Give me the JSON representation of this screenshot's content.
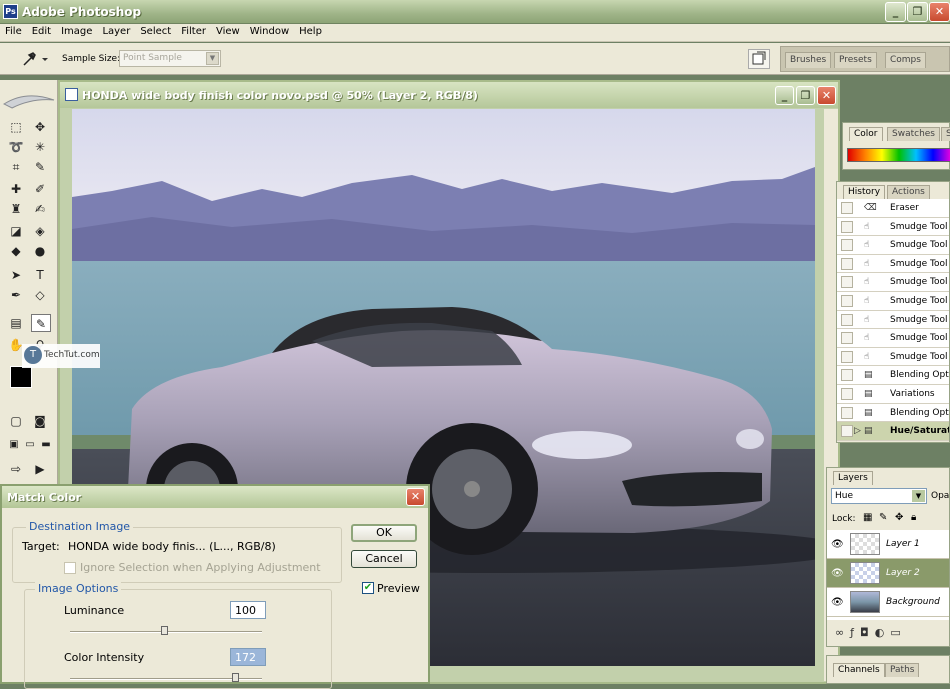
{
  "app": {
    "title": "Adobe Photoshop",
    "logo_text": "Ps"
  },
  "window_buttons": {
    "minimize": "_",
    "restore": "❐",
    "close": "✕"
  },
  "menu": [
    "File",
    "Edit",
    "Image",
    "Layer",
    "Select",
    "Filter",
    "View",
    "Window",
    "Help"
  ],
  "options_bar": {
    "sample_size_label": "Sample Size:",
    "sample_size_value": "Point Sample",
    "palette_well_tabs": [
      "Brushes",
      "Presets",
      "Comps"
    ]
  },
  "document": {
    "title": "HONDA wide body finish color novo.psd @ 50% (Layer 2, RGB/8)"
  },
  "watermark": {
    "text": "TechTut.com"
  },
  "color_panel": {
    "tabs": [
      "Color",
      "Swatches",
      "S"
    ]
  },
  "history_panel": {
    "tabs": [
      "History",
      "Actions"
    ],
    "items": [
      {
        "label": "Eraser",
        "icon": "eraser-icon"
      },
      {
        "label": "Smudge Tool",
        "icon": "smudge-icon"
      },
      {
        "label": "Smudge Tool",
        "icon": "smudge-icon"
      },
      {
        "label": "Smudge Tool",
        "icon": "smudge-icon"
      },
      {
        "label": "Smudge Tool",
        "icon": "smudge-icon"
      },
      {
        "label": "Smudge Tool",
        "icon": "smudge-icon"
      },
      {
        "label": "Smudge Tool",
        "icon": "smudge-icon"
      },
      {
        "label": "Smudge Tool",
        "icon": "smudge-icon"
      },
      {
        "label": "Smudge Tool",
        "icon": "smudge-icon"
      },
      {
        "label": "Blending Optio",
        "icon": "doc-icon"
      },
      {
        "label": "Variations",
        "icon": "doc-icon"
      },
      {
        "label": "Blending Optio",
        "icon": "doc-icon"
      },
      {
        "label": "Hue/Saturatio",
        "icon": "doc-icon",
        "selected": true
      }
    ]
  },
  "layers_panel": {
    "tab": "Layers",
    "blend_mode": "Hue",
    "opacity_label": "Opa",
    "lock_label": "Lock:",
    "layers": [
      {
        "name": "Layer 1",
        "selected": false
      },
      {
        "name": "Layer 2",
        "selected": true
      },
      {
        "name": "Background",
        "selected": false
      }
    ]
  },
  "bottom_panel": {
    "tabs": [
      "Channels",
      "Paths"
    ]
  },
  "match_color_dialog": {
    "title": "Match Color",
    "close": "✕",
    "destination_group": "Destination Image",
    "target_label": "Target:",
    "target_value": "HONDA wide body finis... (L..., RGB/8)",
    "ignore_selection_label": "Ignore Selection when Applying Adjustment",
    "image_options_group": "Image Options",
    "luminance_label": "Luminance",
    "luminance_value": "100",
    "color_intensity_label": "Color Intensity",
    "color_intensity_value": "172",
    "ok_label": "OK",
    "cancel_label": "Cancel",
    "preview_label": "Preview",
    "preview_checked": true
  },
  "colors": {
    "chrome_green": "#9fb488",
    "panel_bg": "#ece9d8",
    "group_title_blue": "#2257a8"
  }
}
